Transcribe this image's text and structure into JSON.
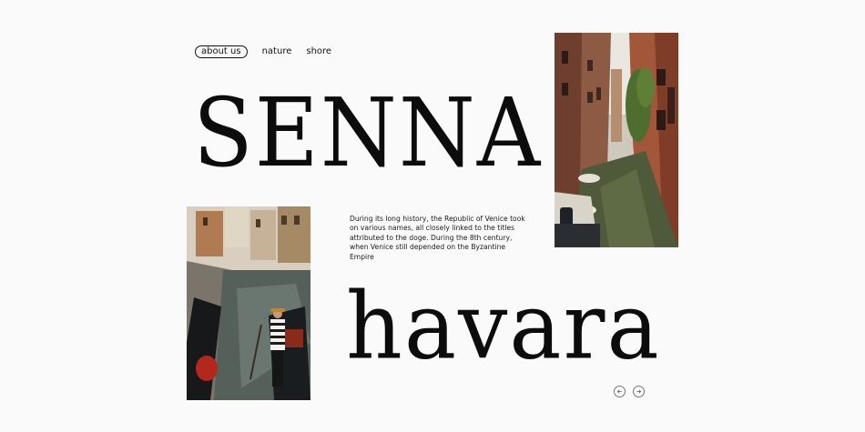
{
  "nav": {
    "items": [
      {
        "label": "about us",
        "active": true
      },
      {
        "label": "nature",
        "active": false
      },
      {
        "label": "shore",
        "active": false
      }
    ]
  },
  "hero": {
    "line1": "SENNA",
    "line2": "havara"
  },
  "body_text": "During its long history, the Republic of Venice took on various names, all closely linked to the titles attributed to the doge. During the 8th century, when Venice still depended on the Byzantine Empire",
  "photos": {
    "canal": {
      "icon": "venice-canal-photo"
    },
    "gondola": {
      "icon": "gondolier-photo"
    }
  },
  "pager": {
    "prev_icon": "arrow-left-icon",
    "next_icon": "arrow-right-icon"
  },
  "colors": {
    "background": "#fafafa",
    "text": "#111111",
    "canal_water": "#4f5a3a",
    "brick": "#8a4a33",
    "gondolier_stripe": "#1b1b1b"
  }
}
